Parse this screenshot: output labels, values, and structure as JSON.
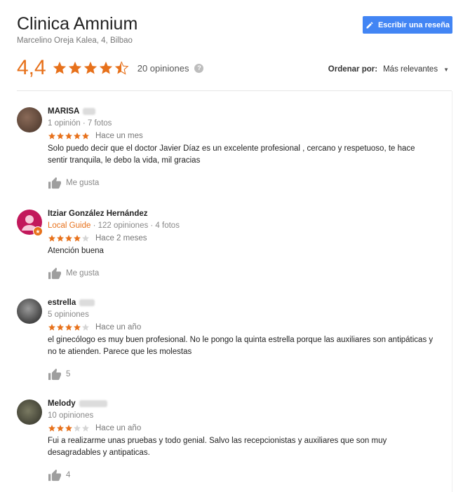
{
  "header": {
    "title": "Clinica Amnium",
    "address": "Marcelino Oreja Kalea, 4, Bilbao",
    "write_review_label": "Escribir una reseña"
  },
  "summary": {
    "rating": "4,4",
    "rating_value": 4.4,
    "reviews_count": "20 opiniones"
  },
  "sort": {
    "label": "Ordenar por:",
    "value": "Más relevantes"
  },
  "colors": {
    "accent": "#e7711b",
    "button": "#4285f4"
  },
  "reviews": [
    {
      "name": "MARISA",
      "meta": "1 opinión · 7 fotos",
      "stars": 5,
      "when": "Hace un mes",
      "text": "Solo puedo decir que el doctor Javier Díaz es un excelente profesional , cercano y respetuoso, te hace sentir tranquila, le debo la vida, mil gracias",
      "like_label": "Me gusta"
    },
    {
      "name": "Itziar González Hernández",
      "guide": "Local Guide",
      "meta": " · 122 opiniones · 4 fotos",
      "stars": 4,
      "when": "Hace 2 meses",
      "text": "Atención buena",
      "like_label": "Me gusta"
    },
    {
      "name": "estrella",
      "meta": "5 opiniones",
      "stars": 4,
      "when": "Hace un año",
      "text": "el ginecólogo es muy buen profesional. No le pongo la quinta estrella porque las auxiliares son antipáticas y no te atienden. Parece que les molestas",
      "like_label": "5"
    },
    {
      "name": "Melody",
      "meta": "10 opiniones",
      "stars": 3,
      "when": "Hace un año",
      "text": "Fui a realizarme unas pruebas y todo genial. Salvo las recepcionistas y auxiliares que son muy desagradables y antipaticas.",
      "like_label": "4"
    }
  ]
}
